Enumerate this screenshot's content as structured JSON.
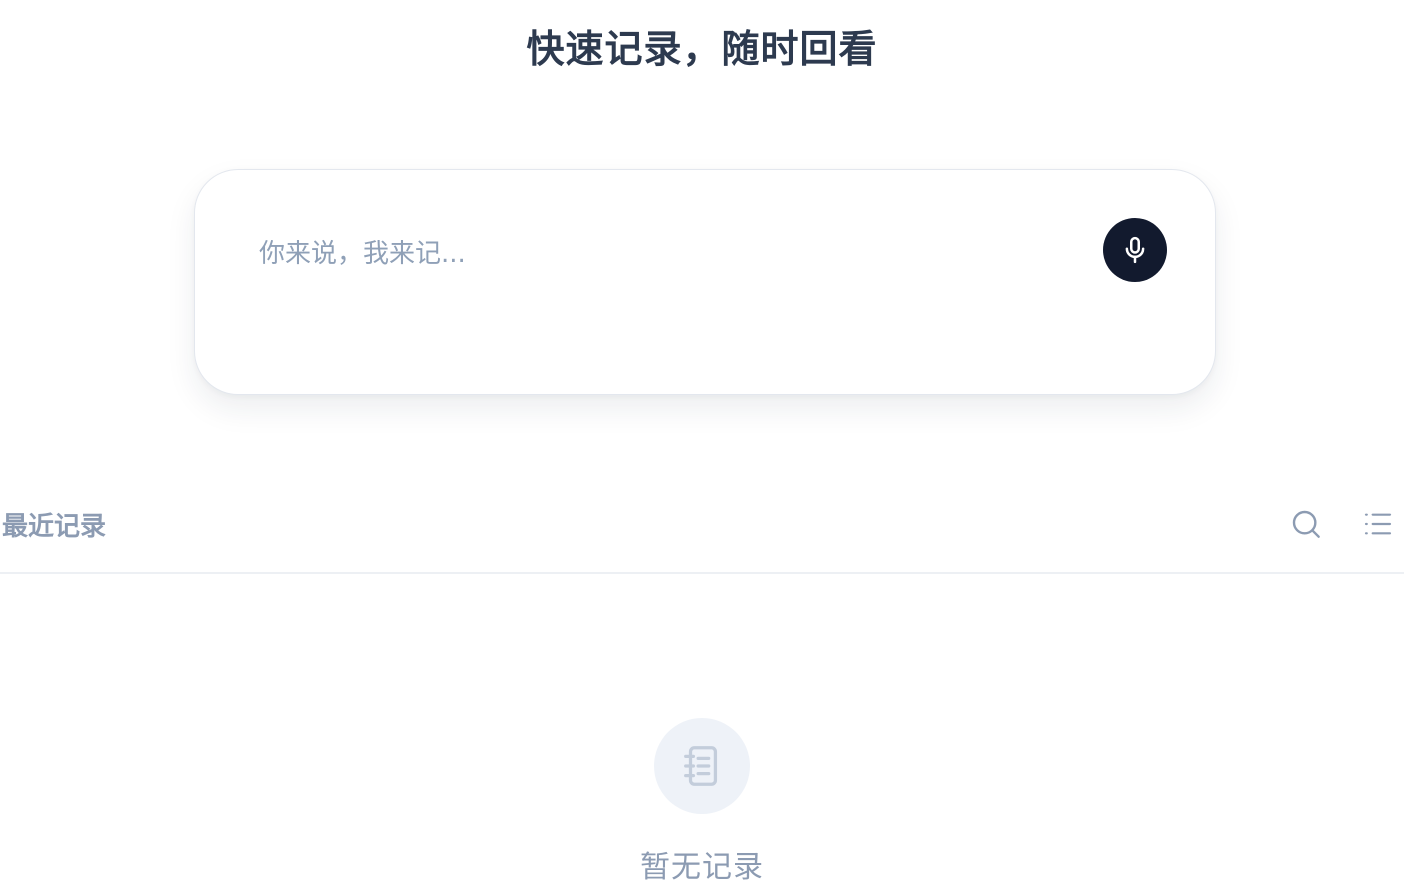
{
  "header": {
    "title": "快速记录，随时回看"
  },
  "composer": {
    "placeholder": "你来说，我来记...",
    "value": "",
    "mic_icon": "microphone-icon"
  },
  "records": {
    "section_title": "最近记录",
    "search_icon": "search-icon",
    "list_icon": "list-icon",
    "empty_icon": "notebook-icon",
    "empty_text": "暂无记录"
  },
  "colors": {
    "title": "#2d3a4f",
    "mic_button_bg": "#121a2e",
    "muted_text": "#8c9bb2",
    "placeholder": "#8fa0b7",
    "empty_icon_bg": "#eef2f8"
  }
}
